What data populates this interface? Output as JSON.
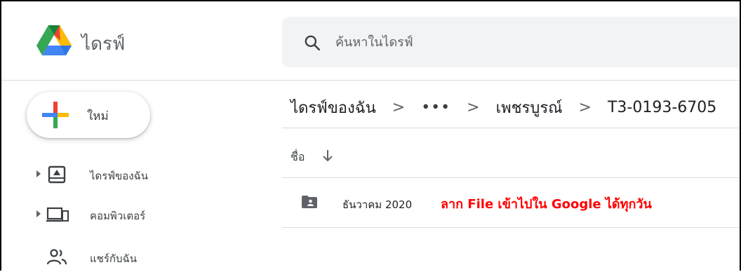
{
  "header": {
    "app_title": "ไดรฟ์",
    "logo_icon": "google-drive-logo",
    "search": {
      "icon": "search-icon",
      "placeholder": "ค้นหาในไดรฟ์",
      "value": ""
    }
  },
  "sidebar": {
    "new_button": {
      "label": "ใหม่",
      "icon": "plus-icon"
    },
    "items": [
      {
        "label": "ไดรฟ์ของฉัน",
        "icon": "my-drive-icon",
        "expandable": true
      },
      {
        "label": "คอมพิวเตอร์",
        "icon": "computer-icon",
        "expandable": true
      },
      {
        "label": "แชร์กับฉัน",
        "icon": "shared-with-me-icon",
        "expandable": false
      }
    ]
  },
  "breadcrumb": {
    "items": [
      "ไดรฟ์ของฉัน",
      "•••",
      "เพชรบูรณ์",
      "T3-0193-6705"
    ],
    "separator": ">"
  },
  "file_list": {
    "column_header": "ชื่อ",
    "sort_icon": "arrow-down-icon",
    "rows": [
      {
        "name": "ธันวาคม 2020",
        "icon": "shared-folder-icon"
      }
    ]
  },
  "annotation": {
    "text": "ลาก File เข้าไปใน Google ได้ทุกวัน",
    "color": "#ff0000"
  },
  "colors": {
    "google_blue": "#4285f4",
    "google_red": "#ea4335",
    "google_yellow": "#fbbc04",
    "google_green": "#34a853",
    "icon_gray": "#5f6368"
  }
}
